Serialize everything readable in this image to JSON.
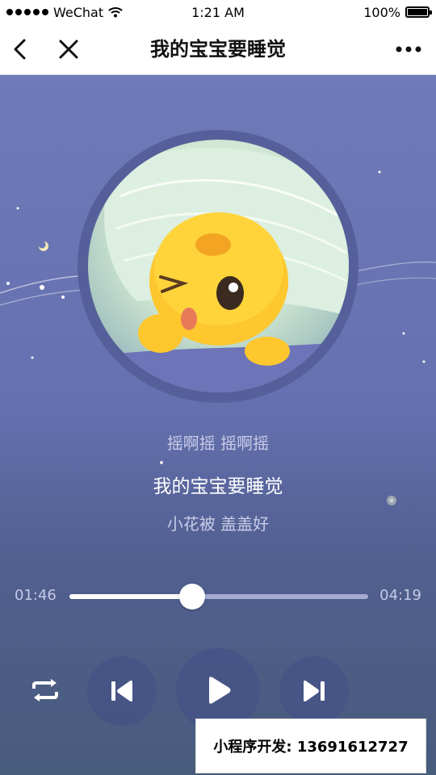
{
  "status_bar": {
    "carrier": "WeChat",
    "time": "1:21 AM",
    "battery": "100%",
    "battery_level": 1.0
  },
  "nav": {
    "title": "我的宝宝要睡觉",
    "back_icon": "chevron-left-icon",
    "close_icon": "close-icon",
    "more_icon": "more-dots-icon"
  },
  "lyrics": {
    "previous": "摇啊摇   摇啊摇",
    "current": "我的宝宝要睡觉",
    "next": "小花被   盖盖好"
  },
  "player": {
    "current_time": "01:46",
    "total_time": "04:19",
    "progress": 0.41
  },
  "controls": {
    "repeat_icon": "repeat-icon",
    "prev_icon": "skip-previous-icon",
    "play_icon": "play-icon",
    "next_icon": "skip-next-icon"
  },
  "watermark": {
    "text": "小程序开发:  13691612727"
  },
  "colors": {
    "scene_bg": "#6571b0",
    "lyric_dim": "#c9cde8",
    "lyric_active": "#ffffff"
  }
}
